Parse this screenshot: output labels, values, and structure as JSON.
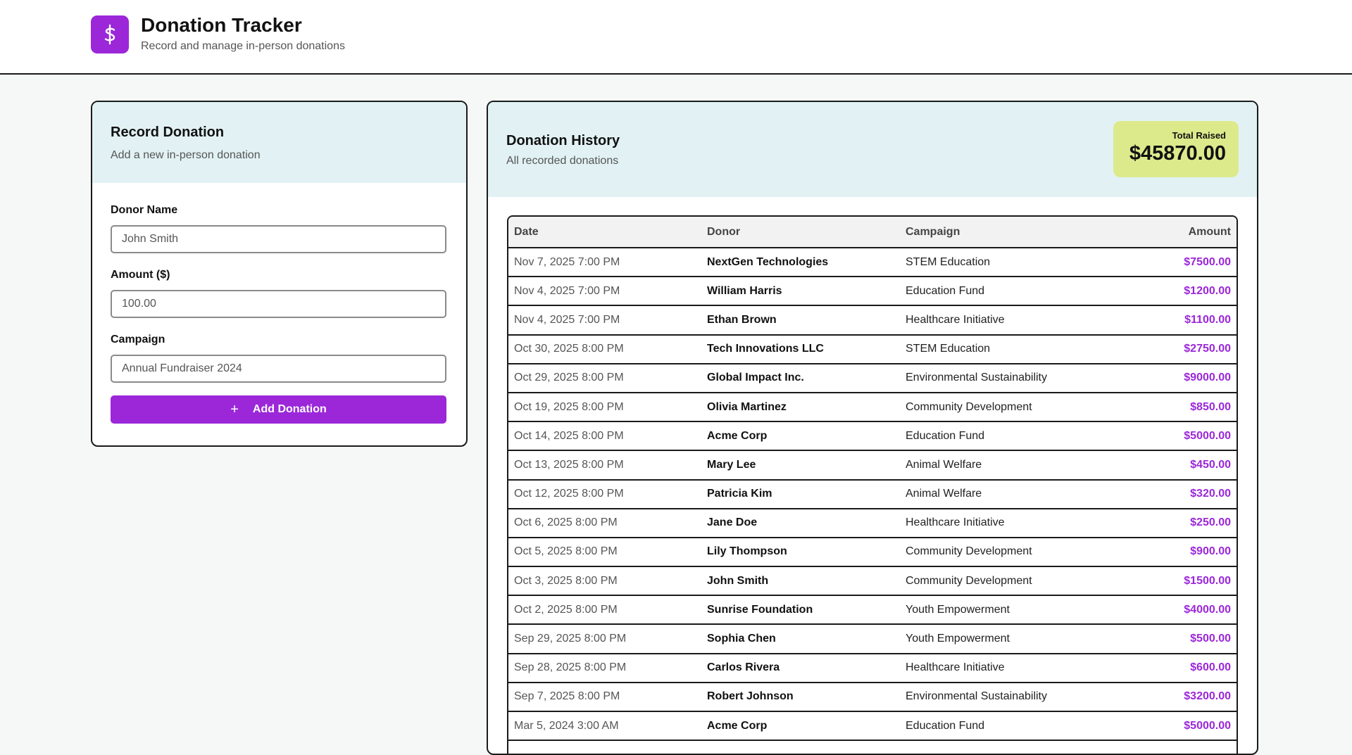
{
  "header": {
    "title": "Donation Tracker",
    "subtitle": "Record and manage in-person donations",
    "logo_icon": "dollar-icon"
  },
  "record_form": {
    "title": "Record Donation",
    "subtitle": "Add a new in-person donation",
    "donor_label": "Donor Name",
    "donor_placeholder": "John Smith",
    "amount_label": "Amount ($)",
    "amount_placeholder": "100.00",
    "campaign_label": "Campaign",
    "campaign_placeholder": "Annual Fundraiser 2024",
    "submit_label": "Add Donation"
  },
  "history": {
    "title": "Donation History",
    "subtitle": "All recorded donations",
    "total_label": "Total Raised",
    "total_value": "$45870.00",
    "columns": [
      "Date",
      "Donor",
      "Campaign",
      "Amount"
    ],
    "rows": [
      {
        "date": "Nov 7, 2025 7:00 PM",
        "donor": "NextGen Technologies",
        "campaign": "STEM Education",
        "amount": "$7500.00"
      },
      {
        "date": "Nov 4, 2025 7:00 PM",
        "donor": "William Harris",
        "campaign": "Education Fund",
        "amount": "$1200.00"
      },
      {
        "date": "Nov 4, 2025 7:00 PM",
        "donor": "Ethan Brown",
        "campaign": "Healthcare Initiative",
        "amount": "$1100.00"
      },
      {
        "date": "Oct 30, 2025 8:00 PM",
        "donor": "Tech Innovations LLC",
        "campaign": "STEM Education",
        "amount": "$2750.00"
      },
      {
        "date": "Oct 29, 2025 8:00 PM",
        "donor": "Global Impact Inc.",
        "campaign": "Environmental Sustainability",
        "amount": "$9000.00"
      },
      {
        "date": "Oct 19, 2025 8:00 PM",
        "donor": "Olivia Martinez",
        "campaign": "Community Development",
        "amount": "$850.00"
      },
      {
        "date": "Oct 14, 2025 8:00 PM",
        "donor": "Acme Corp",
        "campaign": "Education Fund",
        "amount": "$5000.00"
      },
      {
        "date": "Oct 13, 2025 8:00 PM",
        "donor": "Mary Lee",
        "campaign": "Animal Welfare",
        "amount": "$450.00"
      },
      {
        "date": "Oct 12, 2025 8:00 PM",
        "donor": "Patricia Kim",
        "campaign": "Animal Welfare",
        "amount": "$320.00"
      },
      {
        "date": "Oct 6, 2025 8:00 PM",
        "donor": "Jane Doe",
        "campaign": "Healthcare Initiative",
        "amount": "$250.00"
      },
      {
        "date": "Oct 5, 2025 8:00 PM",
        "donor": "Lily Thompson",
        "campaign": "Community Development",
        "amount": "$900.00"
      },
      {
        "date": "Oct 3, 2025 8:00 PM",
        "donor": "John Smith",
        "campaign": "Community Development",
        "amount": "$1500.00"
      },
      {
        "date": "Oct 2, 2025 8:00 PM",
        "donor": "Sunrise Foundation",
        "campaign": "Youth Empowerment",
        "amount": "$4000.00"
      },
      {
        "date": "Sep 29, 2025 8:00 PM",
        "donor": "Sophia Chen",
        "campaign": "Youth Empowerment",
        "amount": "$500.00"
      },
      {
        "date": "Sep 28, 2025 8:00 PM",
        "donor": "Carlos Rivera",
        "campaign": "Healthcare Initiative",
        "amount": "$600.00"
      },
      {
        "date": "Sep 7, 2025 8:00 PM",
        "donor": "Robert Johnson",
        "campaign": "Environmental Sustainability",
        "amount": "$3200.00"
      },
      {
        "date": "Mar 5, 2024 3:00 AM",
        "donor": "Acme Corp",
        "campaign": "Education Fund",
        "amount": "$5000.00"
      }
    ]
  },
  "colors": {
    "accent": "#9b27d9",
    "header_bg": "#e2f2f4",
    "total_bg": "#dcea8c",
    "page_bg": "#f5f8f6"
  }
}
